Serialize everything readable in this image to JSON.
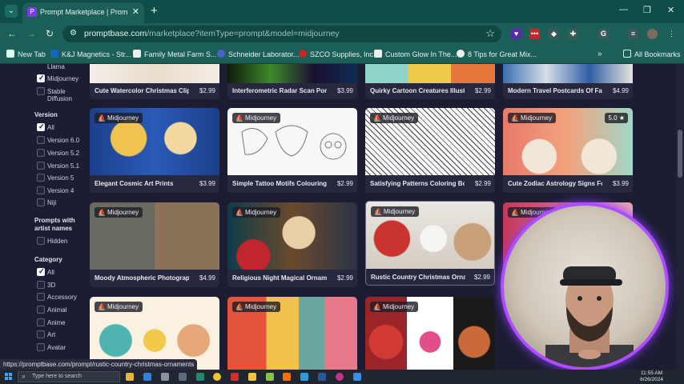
{
  "browser": {
    "tab_title": "Prompt Marketplace | PromptB...",
    "url_host": "promptbase.com",
    "url_path": "/marketplace?itemType=prompt&model=midjourney",
    "bookmarks": [
      {
        "label": "New Tab"
      },
      {
        "label": "K&J Magnetics - Str..."
      },
      {
        "label": "Family Metal Farm S..."
      },
      {
        "label": "Schneider Laborator..."
      },
      {
        "label": "SZCO Supplies, Inc."
      },
      {
        "label": "Custom Glow In The..."
      },
      {
        "label": "8 Tips for Great Mix..."
      }
    ],
    "all_bookmarks": "All Bookmarks"
  },
  "sidebar": {
    "model_items": [
      {
        "label": "Llama",
        "checked": false
      },
      {
        "label": "Midjourney",
        "checked": true
      },
      {
        "label": "Stable",
        "label2": "Diffusion",
        "checked": false
      }
    ],
    "version_title": "Version",
    "version_items": [
      {
        "label": "All",
        "checked": true
      },
      {
        "label": "Version 6.0",
        "checked": false
      },
      {
        "label": "Version 5.2",
        "checked": false
      },
      {
        "label": "Version 5.1",
        "checked": false
      },
      {
        "label": "Version 5",
        "checked": false
      },
      {
        "label": "Version 4",
        "checked": false
      },
      {
        "label": "Niji",
        "checked": false
      }
    ],
    "artist_title": "Prompts with",
    "artist_title2": "artist names",
    "artist_items": [
      {
        "label": "Hidden",
        "checked": false
      }
    ],
    "category_title": "Category",
    "category_items": [
      {
        "label": "All",
        "checked": true
      },
      {
        "label": "3D",
        "checked": false
      },
      {
        "label": "Accessory",
        "checked": false
      },
      {
        "label": "Animal",
        "checked": false
      },
      {
        "label": "Anime",
        "checked": false
      },
      {
        "label": "Art",
        "checked": false
      },
      {
        "label": "Avatar",
        "checked": false
      }
    ]
  },
  "top_row": [
    {
      "name": "Cute Watercolor Christmas Cliparts",
      "price": "$2.99"
    },
    {
      "name": "Interferometric Radar Scan Portraits",
      "price": "$3.99"
    },
    {
      "name": "Quirky Cartoon Creatures Illustratio...",
      "price": "$2.99"
    },
    {
      "name": "Modern Travel Postcards Of Famous...",
      "price": "$4.99"
    }
  ],
  "cards": [
    {
      "badge": "Midjourney",
      "name": "Elegant Cosmic Art Prints",
      "price": "$3.99"
    },
    {
      "badge": "Midjourney",
      "name": "Simple Tattoo Motifs Colouring Pages",
      "price": "$2.99"
    },
    {
      "badge": "Midjourney",
      "name": "Satisfying Patterns Coloring Books ...",
      "price": "$2.99"
    },
    {
      "badge": "Midjourney",
      "name": "Cute Zodiac Astrology Signs For Kids",
      "price": "$3.99",
      "rating": "5.0 ★"
    },
    {
      "badge": "Midjourney",
      "name": "Moody Atmospheric Photographs",
      "price": "$4.99"
    },
    {
      "badge": "Midjourney",
      "name": "Religious Night Magical Ornaments",
      "price": "$2.99"
    },
    {
      "badge": "Midjourney",
      "name": "Rustic Country Christmas Ornaments",
      "price": "$2.99"
    },
    {
      "badge": "Midjourney",
      "name": "",
      "price": ""
    },
    {
      "badge": "Midjourney",
      "name": "",
      "price": ""
    },
    {
      "badge": "Midjourney",
      "name": "",
      "price": ""
    },
    {
      "badge": "Midjourney",
      "name": "",
      "price": ""
    }
  ],
  "status_url": "https://promptbase.com/prompt/rustic-country-christmas-ornaments",
  "taskbar": {
    "search_placeholder": "Type here to search",
    "time": "11:55 AM",
    "date": "6/26/2024"
  }
}
